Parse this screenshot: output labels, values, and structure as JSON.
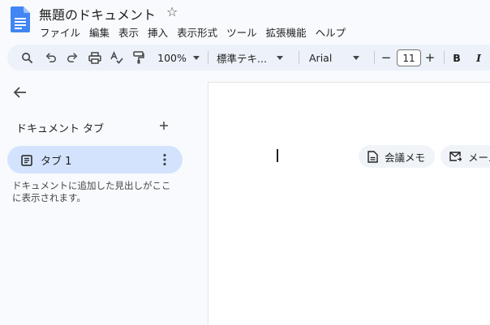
{
  "title_bar": {
    "document_title": "無題のドキュメント",
    "star_icon": "star-outline-icon"
  },
  "menu": [
    "ファイル",
    "編集",
    "表示",
    "挿入",
    "表示形式",
    "ツール",
    "拡張機能",
    "ヘルプ"
  ],
  "toolbar": {
    "zoom": "100%",
    "paragraph_style": "標準テキ...",
    "font": "Arial",
    "font_size": "11",
    "decrease_label": "−",
    "increase_label": "+",
    "bold_label": "B",
    "italic_label": "I",
    "icons": [
      "search-icon",
      "undo-icon",
      "redo-icon",
      "print-icon",
      "spellcheck-icon",
      "paint-format-icon"
    ]
  },
  "sidebar": {
    "heading": "ドキュメント タブ",
    "tabs": [
      {
        "label": "タブ 1"
      }
    ],
    "hint": "ドキュメントに追加した見出しがここに表示されます。"
  },
  "canvas": {
    "chips": [
      {
        "label": "会議メモ",
        "icon": "document-icon"
      },
      {
        "label": "メール",
        "icon": "email-draft-icon"
      }
    ]
  },
  "colors": {
    "background": "#f8fafd",
    "toolbar": "#edf2fa",
    "active_tab": "#d3e3fd",
    "docs_blue": "#4285f4"
  }
}
